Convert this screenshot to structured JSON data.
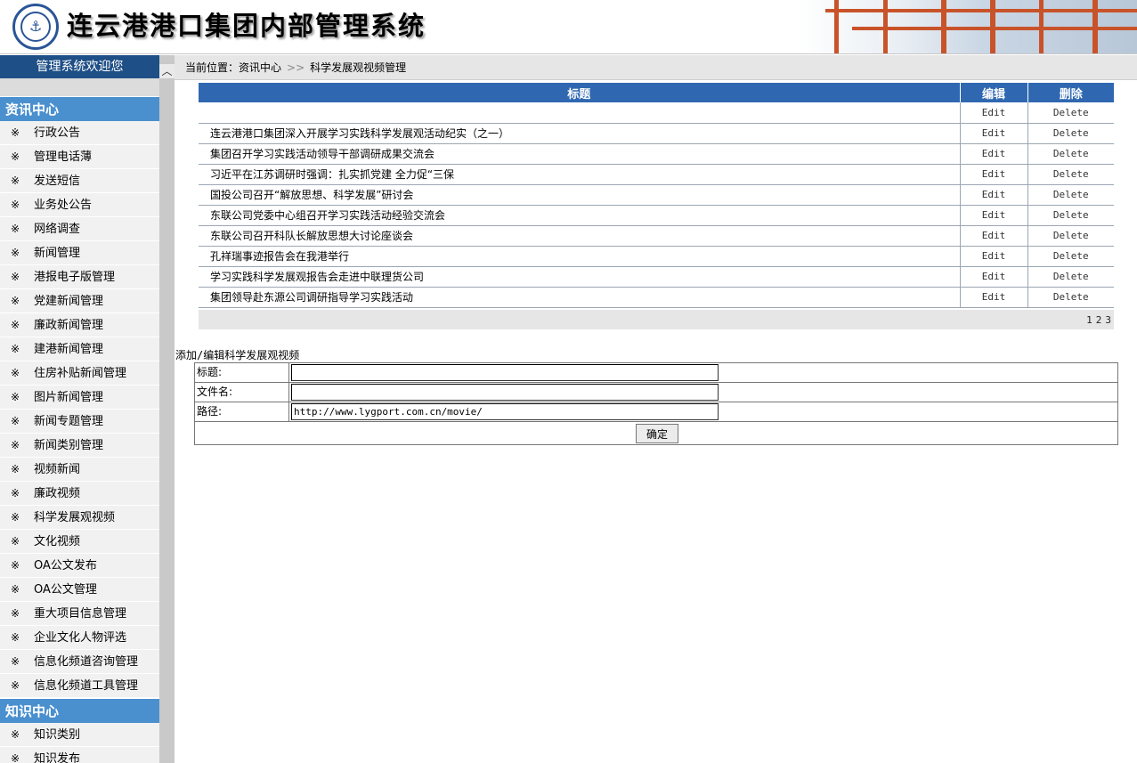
{
  "header": {
    "title": "连云港港口集团内部管理系统"
  },
  "sidebar": {
    "welcome": "管理系统欢迎您",
    "bullet": "※",
    "sections": [
      {
        "title": "资讯中心",
        "items": [
          "行政公告",
          "管理电话薄",
          "发送短信",
          "业务处公告",
          "网络调查",
          "新闻管理",
          "港报电子版管理",
          "党建新闻管理",
          "廉政新闻管理",
          "建港新闻管理",
          "住房补贴新闻管理",
          "图片新闻管理",
          "新闻专题管理",
          "新闻类别管理",
          "视频新闻",
          "廉政视频",
          "科学发展观视频",
          "文化视频",
          "OA公文发布",
          "OA公文管理",
          "重大项目信息管理",
          "企业文化人物评选",
          "信息化频道咨询管理",
          "信息化频道工具管理"
        ]
      },
      {
        "title": "知识中心",
        "items": [
          "知识类别",
          "知识发布"
        ]
      }
    ]
  },
  "breadcrumb": {
    "prefix": "当前位置：",
    "section": "资讯中心",
    "separator": ">>",
    "page": "科学发展观视频管理"
  },
  "table": {
    "headers": {
      "title": "标题",
      "edit": "编辑",
      "delete": "删除"
    },
    "edit_label": "Edit",
    "delete_label": "Delete",
    "rows": [
      "",
      "连云港港口集团深入开展学习实践科学发展观活动纪实（之一）",
      "集团召开学习实践活动领导干部调研成果交流会",
      "习近平在江苏调研时强调：扎实抓党建 全力促“三保",
      "国投公司召开“解放思想、科学发展”研讨会",
      "东联公司党委中心组召开学习实践活动经验交流会",
      "东联公司召开科队长解放思想大讨论座谈会",
      "孔祥瑞事迹报告会在我港举行",
      "学习实践科学发展观报告会走进中联理货公司",
      "集团领导赴东源公司调研指导学习实践活动"
    ],
    "pages": [
      "1",
      "2",
      "3"
    ]
  },
  "form": {
    "title": "添加/编辑科学发展观视频",
    "fields": {
      "title_label": "标题:",
      "title_value": "",
      "filename_label": "文件名:",
      "filename_value": "",
      "path_label": "路径:",
      "path_value": "http://www.lygport.com.cn/movie/"
    },
    "submit_label": "确定"
  },
  "colors": {
    "welcome_bg": "#1e4f86",
    "section_head_bg": "#4a90cf",
    "table_header_bg": "#2f68b0"
  }
}
